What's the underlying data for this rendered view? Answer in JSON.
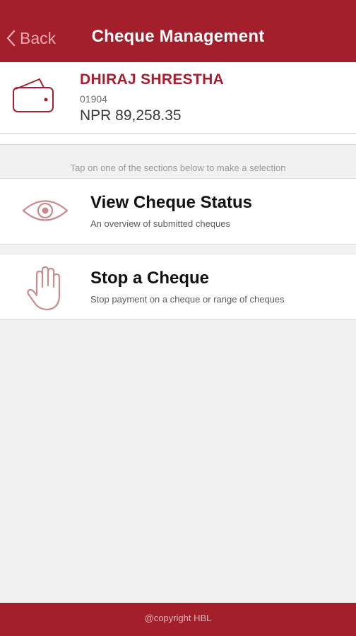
{
  "header": {
    "back_label": "Back",
    "title": "Cheque Management"
  },
  "account": {
    "name": "DHIRAJ SHRESTHA",
    "number": "01904",
    "balance": "NPR 89,258.35"
  },
  "hint": "Tap on one of the sections below to make a selection",
  "options": [
    {
      "icon": "eye-icon",
      "title": "View Cheque Status",
      "subtitle": "An overview of submitted cheques"
    },
    {
      "icon": "hand-icon",
      "title": "Stop a Cheque",
      "subtitle": "Stop payment on a cheque or range of cheques"
    }
  ],
  "footer": {
    "copyright": "@copyright HBL"
  },
  "colors": {
    "brand": "#a41f2c",
    "background": "#f1f1f1",
    "icon_tint": "#c98a90"
  }
}
